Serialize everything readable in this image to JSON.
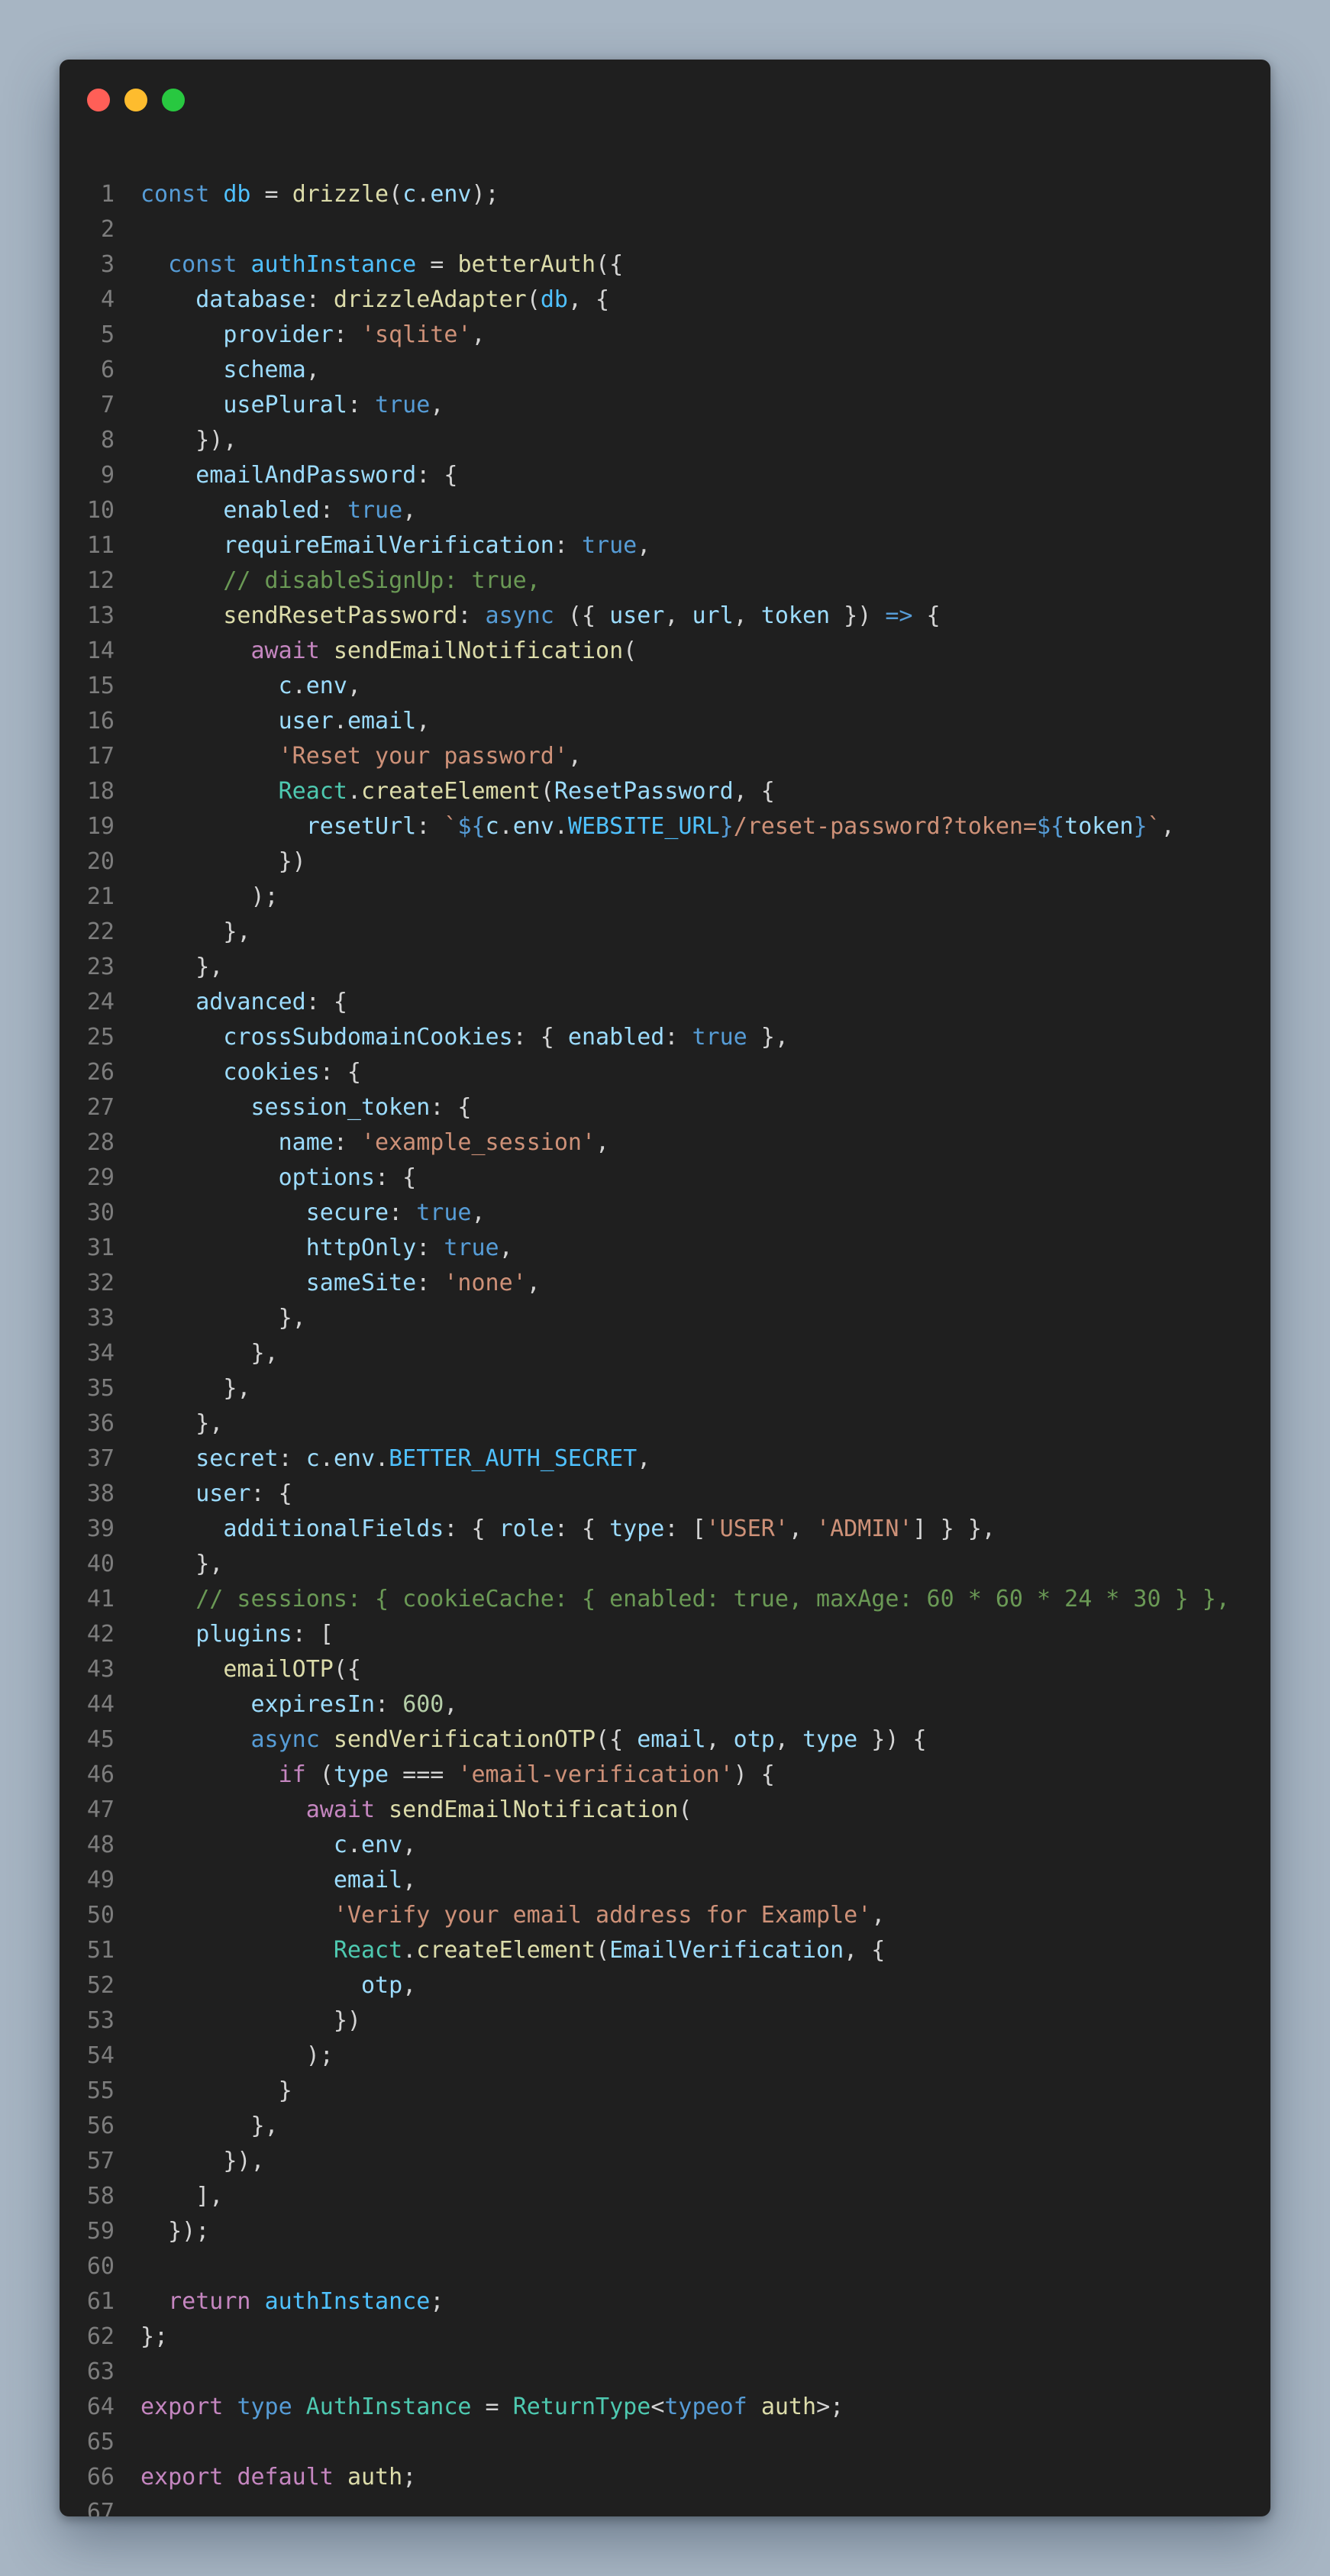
{
  "window": {
    "controls": [
      {
        "name": "close",
        "color": "#ff5f57"
      },
      {
        "name": "minimize",
        "color": "#febc2e"
      },
      {
        "name": "maximize",
        "color": "#28c840"
      }
    ]
  },
  "editor": {
    "lines": [
      [
        [
          "kw",
          "const"
        ],
        [
          "pl",
          " "
        ],
        [
          "cst",
          "db"
        ],
        [
          "pl",
          " = "
        ],
        [
          "fn",
          "drizzle"
        ],
        [
          "pl",
          "("
        ],
        [
          "prop",
          "c"
        ],
        [
          "pl",
          "."
        ],
        [
          "prop",
          "env"
        ],
        [
          "pl",
          ");"
        ]
      ],
      [],
      [
        [
          "pl",
          "  "
        ],
        [
          "kw",
          "const"
        ],
        [
          "pl",
          " "
        ],
        [
          "cst",
          "authInstance"
        ],
        [
          "pl",
          " = "
        ],
        [
          "fn",
          "betterAuth"
        ],
        [
          "pl",
          "({"
        ]
      ],
      [
        [
          "pl",
          "    "
        ],
        [
          "prop",
          "database"
        ],
        [
          "pl",
          ": "
        ],
        [
          "fn",
          "drizzleAdapter"
        ],
        [
          "pl",
          "("
        ],
        [
          "cst",
          "db"
        ],
        [
          "pl",
          ", {"
        ]
      ],
      [
        [
          "pl",
          "      "
        ],
        [
          "prop",
          "provider"
        ],
        [
          "pl",
          ": "
        ],
        [
          "str",
          "'sqlite'"
        ],
        [
          "pl",
          ","
        ]
      ],
      [
        [
          "pl",
          "      "
        ],
        [
          "prop",
          "schema"
        ],
        [
          "pl",
          ","
        ]
      ],
      [
        [
          "pl",
          "      "
        ],
        [
          "prop",
          "usePlural"
        ],
        [
          "pl",
          ": "
        ],
        [
          "kw",
          "true"
        ],
        [
          "pl",
          ","
        ]
      ],
      [
        [
          "pl",
          "    }),"
        ]
      ],
      [
        [
          "pl",
          "    "
        ],
        [
          "prop",
          "emailAndPassword"
        ],
        [
          "pl",
          ": {"
        ]
      ],
      [
        [
          "pl",
          "      "
        ],
        [
          "prop",
          "enabled"
        ],
        [
          "pl",
          ": "
        ],
        [
          "kw",
          "true"
        ],
        [
          "pl",
          ","
        ]
      ],
      [
        [
          "pl",
          "      "
        ],
        [
          "prop",
          "requireEmailVerification"
        ],
        [
          "pl",
          ": "
        ],
        [
          "kw",
          "true"
        ],
        [
          "pl",
          ","
        ]
      ],
      [
        [
          "pl",
          "      "
        ],
        [
          "cmt",
          "// disableSignUp: true,"
        ]
      ],
      [
        [
          "pl",
          "      "
        ],
        [
          "fn",
          "sendResetPassword"
        ],
        [
          "pl",
          ": "
        ],
        [
          "kw",
          "async"
        ],
        [
          "pl",
          " ({ "
        ],
        [
          "prop",
          "user"
        ],
        [
          "pl",
          ", "
        ],
        [
          "prop",
          "url"
        ],
        [
          "pl",
          ", "
        ],
        [
          "prop",
          "token"
        ],
        [
          "pl",
          " }) "
        ],
        [
          "kw",
          "=>"
        ],
        [
          "pl",
          " {"
        ]
      ],
      [
        [
          "pl",
          "        "
        ],
        [
          "ctl",
          "await"
        ],
        [
          "pl",
          " "
        ],
        [
          "fn",
          "sendEmailNotification"
        ],
        [
          "pl",
          "("
        ]
      ],
      [
        [
          "pl",
          "          "
        ],
        [
          "prop",
          "c"
        ],
        [
          "pl",
          "."
        ],
        [
          "prop",
          "env"
        ],
        [
          "pl",
          ","
        ]
      ],
      [
        [
          "pl",
          "          "
        ],
        [
          "prop",
          "user"
        ],
        [
          "pl",
          "."
        ],
        [
          "prop",
          "email"
        ],
        [
          "pl",
          ","
        ]
      ],
      [
        [
          "pl",
          "          "
        ],
        [
          "str",
          "'Reset your password'"
        ],
        [
          "pl",
          ","
        ]
      ],
      [
        [
          "pl",
          "          "
        ],
        [
          "cls",
          "React"
        ],
        [
          "pl",
          "."
        ],
        [
          "fn",
          "createElement"
        ],
        [
          "pl",
          "("
        ],
        [
          "prop",
          "ResetPassword"
        ],
        [
          "pl",
          ", {"
        ]
      ],
      [
        [
          "pl",
          "            "
        ],
        [
          "prop",
          "resetUrl"
        ],
        [
          "pl",
          ": "
        ],
        [
          "str",
          "`"
        ],
        [
          "kw",
          "${"
        ],
        [
          "prop",
          "c"
        ],
        [
          "pl",
          "."
        ],
        [
          "prop",
          "env"
        ],
        [
          "pl",
          "."
        ],
        [
          "cst",
          "WEBSITE_URL"
        ],
        [
          "kw",
          "}"
        ],
        [
          "str",
          "/reset-password?token="
        ],
        [
          "kw",
          "${"
        ],
        [
          "prop",
          "token"
        ],
        [
          "kw",
          "}"
        ],
        [
          "str",
          "`"
        ],
        [
          "pl",
          ","
        ]
      ],
      [
        [
          "pl",
          "          })"
        ]
      ],
      [
        [
          "pl",
          "        );"
        ]
      ],
      [
        [
          "pl",
          "      },"
        ]
      ],
      [
        [
          "pl",
          "    },"
        ]
      ],
      [
        [
          "pl",
          "    "
        ],
        [
          "prop",
          "advanced"
        ],
        [
          "pl",
          ": {"
        ]
      ],
      [
        [
          "pl",
          "      "
        ],
        [
          "prop",
          "crossSubdomainCookies"
        ],
        [
          "pl",
          ": { "
        ],
        [
          "prop",
          "enabled"
        ],
        [
          "pl",
          ": "
        ],
        [
          "kw",
          "true"
        ],
        [
          "pl",
          " },"
        ]
      ],
      [
        [
          "pl",
          "      "
        ],
        [
          "prop",
          "cookies"
        ],
        [
          "pl",
          ": {"
        ]
      ],
      [
        [
          "pl",
          "        "
        ],
        [
          "prop",
          "session_token"
        ],
        [
          "pl",
          ": {"
        ]
      ],
      [
        [
          "pl",
          "          "
        ],
        [
          "prop",
          "name"
        ],
        [
          "pl",
          ": "
        ],
        [
          "str",
          "'example_session'"
        ],
        [
          "pl",
          ","
        ]
      ],
      [
        [
          "pl",
          "          "
        ],
        [
          "prop",
          "options"
        ],
        [
          "pl",
          ": {"
        ]
      ],
      [
        [
          "pl",
          "            "
        ],
        [
          "prop",
          "secure"
        ],
        [
          "pl",
          ": "
        ],
        [
          "kw",
          "true"
        ],
        [
          "pl",
          ","
        ]
      ],
      [
        [
          "pl",
          "            "
        ],
        [
          "prop",
          "httpOnly"
        ],
        [
          "pl",
          ": "
        ],
        [
          "kw",
          "true"
        ],
        [
          "pl",
          ","
        ]
      ],
      [
        [
          "pl",
          "            "
        ],
        [
          "prop",
          "sameSite"
        ],
        [
          "pl",
          ": "
        ],
        [
          "str",
          "'none'"
        ],
        [
          "pl",
          ","
        ]
      ],
      [
        [
          "pl",
          "          },"
        ]
      ],
      [
        [
          "pl",
          "        },"
        ]
      ],
      [
        [
          "pl",
          "      },"
        ]
      ],
      [
        [
          "pl",
          "    },"
        ]
      ],
      [
        [
          "pl",
          "    "
        ],
        [
          "prop",
          "secret"
        ],
        [
          "pl",
          ": "
        ],
        [
          "prop",
          "c"
        ],
        [
          "pl",
          "."
        ],
        [
          "prop",
          "env"
        ],
        [
          "pl",
          "."
        ],
        [
          "cst",
          "BETTER_AUTH_SECRET"
        ],
        [
          "pl",
          ","
        ]
      ],
      [
        [
          "pl",
          "    "
        ],
        [
          "prop",
          "user"
        ],
        [
          "pl",
          ": {"
        ]
      ],
      [
        [
          "pl",
          "      "
        ],
        [
          "prop",
          "additionalFields"
        ],
        [
          "pl",
          ": { "
        ],
        [
          "prop",
          "role"
        ],
        [
          "pl",
          ": { "
        ],
        [
          "prop",
          "type"
        ],
        [
          "pl",
          ": ["
        ],
        [
          "str",
          "'USER'"
        ],
        [
          "pl",
          ", "
        ],
        [
          "str",
          "'ADMIN'"
        ],
        [
          "pl",
          "] } },"
        ]
      ],
      [
        [
          "pl",
          "    },"
        ]
      ],
      [
        [
          "pl",
          "    "
        ],
        [
          "cmt",
          "// sessions: { cookieCache: { enabled: true, maxAge: 60 * 60 * 24 * 30 } },"
        ]
      ],
      [
        [
          "pl",
          "    "
        ],
        [
          "prop",
          "plugins"
        ],
        [
          "pl",
          ": ["
        ]
      ],
      [
        [
          "pl",
          "      "
        ],
        [
          "fn",
          "emailOTP"
        ],
        [
          "pl",
          "({"
        ]
      ],
      [
        [
          "pl",
          "        "
        ],
        [
          "prop",
          "expiresIn"
        ],
        [
          "pl",
          ": "
        ],
        [
          "num",
          "600"
        ],
        [
          "pl",
          ","
        ]
      ],
      [
        [
          "pl",
          "        "
        ],
        [
          "kw",
          "async"
        ],
        [
          "pl",
          " "
        ],
        [
          "fn",
          "sendVerificationOTP"
        ],
        [
          "pl",
          "({ "
        ],
        [
          "prop",
          "email"
        ],
        [
          "pl",
          ", "
        ],
        [
          "prop",
          "otp"
        ],
        [
          "pl",
          ", "
        ],
        [
          "prop",
          "type"
        ],
        [
          "pl",
          " }) {"
        ]
      ],
      [
        [
          "pl",
          "          "
        ],
        [
          "ctl",
          "if"
        ],
        [
          "pl",
          " ("
        ],
        [
          "prop",
          "type"
        ],
        [
          "pl",
          " === "
        ],
        [
          "str",
          "'email-verification'"
        ],
        [
          "pl",
          ") {"
        ]
      ],
      [
        [
          "pl",
          "            "
        ],
        [
          "ctl",
          "await"
        ],
        [
          "pl",
          " "
        ],
        [
          "fn",
          "sendEmailNotification"
        ],
        [
          "pl",
          "("
        ]
      ],
      [
        [
          "pl",
          "              "
        ],
        [
          "prop",
          "c"
        ],
        [
          "pl",
          "."
        ],
        [
          "prop",
          "env"
        ],
        [
          "pl",
          ","
        ]
      ],
      [
        [
          "pl",
          "              "
        ],
        [
          "prop",
          "email"
        ],
        [
          "pl",
          ","
        ]
      ],
      [
        [
          "pl",
          "              "
        ],
        [
          "str",
          "'Verify your email address for Example'"
        ],
        [
          "pl",
          ","
        ]
      ],
      [
        [
          "pl",
          "              "
        ],
        [
          "cls",
          "React"
        ],
        [
          "pl",
          "."
        ],
        [
          "fn",
          "createElement"
        ],
        [
          "pl",
          "("
        ],
        [
          "prop",
          "EmailVerification"
        ],
        [
          "pl",
          ", {"
        ]
      ],
      [
        [
          "pl",
          "                "
        ],
        [
          "prop",
          "otp"
        ],
        [
          "pl",
          ","
        ]
      ],
      [
        [
          "pl",
          "              })"
        ]
      ],
      [
        [
          "pl",
          "            );"
        ]
      ],
      [
        [
          "pl",
          "          }"
        ]
      ],
      [
        [
          "pl",
          "        },"
        ]
      ],
      [
        [
          "pl",
          "      }),"
        ]
      ],
      [
        [
          "pl",
          "    ],"
        ]
      ],
      [
        [
          "pl",
          "  });"
        ]
      ],
      [],
      [
        [
          "pl",
          "  "
        ],
        [
          "ctl",
          "return"
        ],
        [
          "pl",
          " "
        ],
        [
          "cst",
          "authInstance"
        ],
        [
          "pl",
          ";"
        ]
      ],
      [
        [
          "pl",
          "};"
        ]
      ],
      [],
      [
        [
          "ctl",
          "export"
        ],
        [
          "pl",
          " "
        ],
        [
          "kw",
          "type"
        ],
        [
          "pl",
          " "
        ],
        [
          "cls",
          "AuthInstance"
        ],
        [
          "pl",
          " = "
        ],
        [
          "cls",
          "ReturnType"
        ],
        [
          "pl",
          "<"
        ],
        [
          "kw",
          "typeof"
        ],
        [
          "pl",
          " "
        ],
        [
          "fn",
          "auth"
        ],
        [
          "pl",
          ">;"
        ]
      ],
      [],
      [
        [
          "ctl",
          "export"
        ],
        [
          "pl",
          " "
        ],
        [
          "ctl",
          "default"
        ],
        [
          "pl",
          " "
        ],
        [
          "fn",
          "auth"
        ],
        [
          "pl",
          ";"
        ]
      ],
      []
    ]
  }
}
